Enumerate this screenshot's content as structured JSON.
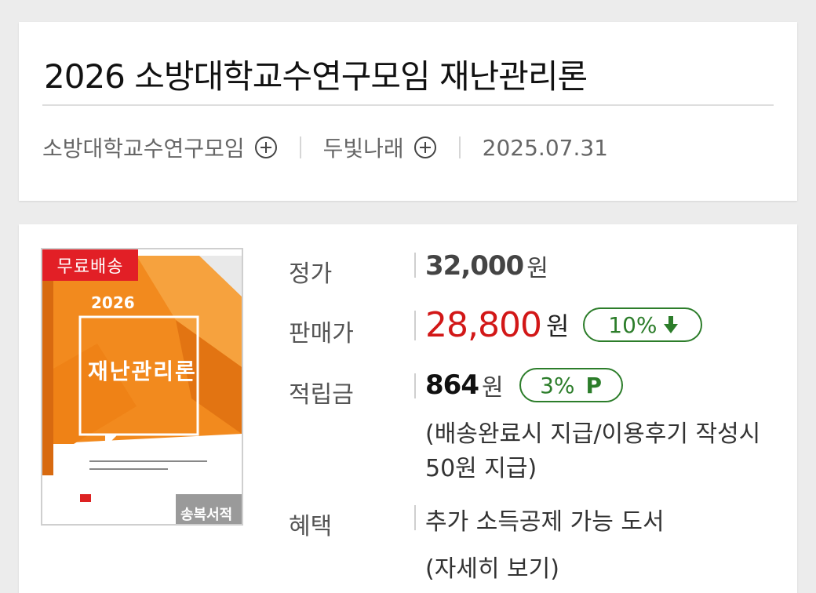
{
  "header": {
    "title": "2026 소방대학교수연구모임 재난관리론",
    "author": "소방대학교수연구모임",
    "publisher": "두빛나래",
    "date": "2025.07.31"
  },
  "product": {
    "badge": "무료배송",
    "cover": {
      "year": "2026",
      "title": "재난관리론",
      "publisher_mark": "송복서적"
    },
    "list_price": {
      "label": "정가",
      "value": "32,000",
      "unit": "원"
    },
    "sale_price": {
      "label": "판매가",
      "value": "28,800",
      "unit": "원",
      "discount": "10%"
    },
    "points": {
      "label": "적립금",
      "value": "864",
      "unit": "원",
      "rate": "3%",
      "rate_suffix": "P",
      "note_line1": "(배송완료시 지급/이용후기 작성시",
      "note_line2": "50원 지급)"
    },
    "benefit": {
      "label": "혜택",
      "value": "추가 소득공제 가능 도서",
      "link": "(자세히 보기)"
    }
  },
  "colors": {
    "sale_red": "#d21717",
    "badge_red": "#e21f26",
    "green": "#2c7d2a",
    "cover_orange": "#f28a1e"
  },
  "icons": {
    "follow": "plus-circle-icon",
    "discount": "arrow-down-icon"
  }
}
